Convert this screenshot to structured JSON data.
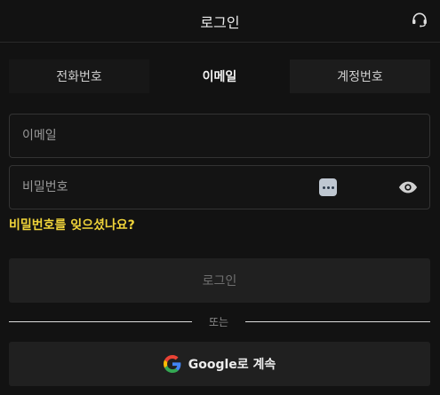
{
  "header": {
    "title": "로그인",
    "support_icon": "headset-icon"
  },
  "tabs": [
    {
      "label": "전화번호",
      "active": false
    },
    {
      "label": "이메일",
      "active": true
    },
    {
      "label": "계정번호",
      "active": false
    }
  ],
  "form": {
    "email": {
      "value": "",
      "placeholder": "이메일"
    },
    "password": {
      "value": "",
      "placeholder": "비밀번호"
    },
    "forgot_label": "비밀번호를 잊으셨나요?",
    "login_label": "로그인"
  },
  "divider_label": "또는",
  "google": {
    "label": "Google로 계속"
  },
  "colors": {
    "accent": "#f0d43a",
    "background": "#121212",
    "button": "#202020"
  }
}
